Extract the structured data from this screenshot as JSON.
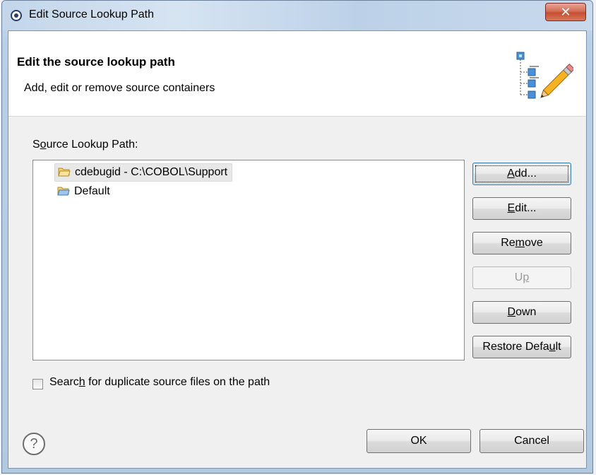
{
  "window": {
    "title": "Edit Source Lookup Path",
    "close_glyph": "✕"
  },
  "banner": {
    "title": "Edit the source lookup path",
    "subtitle": "Add, edit or remove source containers",
    "icon": "source-containers-pencil-icon"
  },
  "source": {
    "label_pre": "S",
    "label_mnemonic": "o",
    "label_post": "urce Lookup Path:",
    "items": [
      {
        "label": "cdebugid - C:\\COBOL\\Support",
        "selected": true
      },
      {
        "label": "Default",
        "selected": false
      }
    ]
  },
  "buttons": {
    "add_mnemonic": "A",
    "add_rest": "dd...",
    "edit_mnemonic": "E",
    "edit_rest": "dit...",
    "remove_pre": "Re",
    "remove_mnemonic": "m",
    "remove_post": "ove",
    "up_pre": "U",
    "up_mnemonic": "p",
    "down_mnemonic": "D",
    "down_rest": "own",
    "restore_pre": "Restore Defa",
    "restore_mnemonic": "u",
    "restore_post": "lt"
  },
  "search_dup": {
    "pre": "Searc",
    "mnemonic": "h",
    "post": " for duplicate source files on the path",
    "checked": false
  },
  "footer": {
    "help_glyph": "?",
    "ok_label": "OK",
    "cancel_label": "Cancel"
  },
  "colors": {
    "titlebar": "#c3d6ea",
    "close": "#c34e32",
    "default_button_border": "#3c7fb1",
    "folder": "#e8b84a",
    "folder_blue": "#5b9bd5"
  }
}
